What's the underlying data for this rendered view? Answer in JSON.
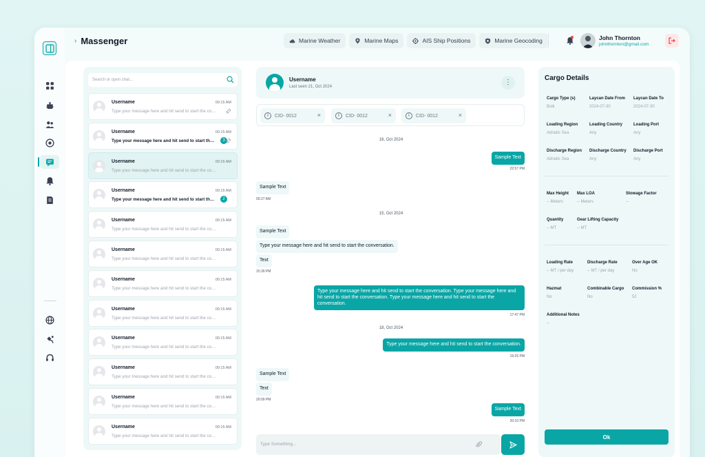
{
  "app": {
    "title": "Massenger"
  },
  "nav": {
    "buttons": [
      {
        "label": "Marine Weather",
        "icon": "cloud-icon"
      },
      {
        "label": "Marine Maps",
        "icon": "map-pin-icon"
      },
      {
        "label": "AIS Ship Positions",
        "icon": "crosshair-icon"
      },
      {
        "label": "Marine Geocoding",
        "icon": "shield-icon"
      }
    ]
  },
  "user": {
    "name": "John Thornton",
    "email": "johnthornton@gmail.com"
  },
  "chat_list": {
    "search_placeholder": "Search or open chat...",
    "items": [
      {
        "name": "Username",
        "time": "00:15 AM",
        "message": "Type your message here and hit send to start the conversation.",
        "unread": false,
        "badge": "",
        "pinned": true
      },
      {
        "name": "Username",
        "time": "00:15 AM",
        "message": "Type your message here and hit send to start the conversation.",
        "unread": true,
        "badge": "3",
        "pinned": true
      },
      {
        "name": "Username",
        "time": "00:15 AM",
        "message": "Type your message here and hit send to start the conversation.",
        "unread": false,
        "badge": "",
        "pinned": false
      },
      {
        "name": "Username",
        "time": "00:15 AM",
        "message": "Type your message here and hit send to start the conversation.",
        "unread": true,
        "badge": "2",
        "pinned": false
      },
      {
        "name": "Username",
        "time": "00:15 AM",
        "message": "Type your message here and hit send to start the conversation.",
        "unread": false,
        "badge": "",
        "pinned": false
      },
      {
        "name": "Username",
        "time": "00:15 AM",
        "message": "Type your message here and hit send to start the conversation.",
        "unread": false,
        "badge": "",
        "pinned": false
      },
      {
        "name": "Username",
        "time": "00:15 AM",
        "message": "Type your message here and hit send to start the conversation.",
        "unread": false,
        "badge": "",
        "pinned": false
      },
      {
        "name": "Username",
        "time": "00:15 AM",
        "message": "Type your message here and hit send to start the conversation.",
        "unread": false,
        "badge": "",
        "pinned": false
      },
      {
        "name": "Username",
        "time": "00:15 AM",
        "message": "Type your message here and hit send to start the conversation.",
        "unread": false,
        "badge": "",
        "pinned": false
      },
      {
        "name": "Username",
        "time": "00:15 AM",
        "message": "Type your message here and hit send to start the conversation.",
        "unread": false,
        "badge": "",
        "pinned": false
      },
      {
        "name": "Username",
        "time": "00:15 AM",
        "message": "Type your message here and hit send to start the conversation.",
        "unread": false,
        "badge": "",
        "pinned": false
      },
      {
        "name": "Username",
        "time": "00:15 AM",
        "message": "Type your message here and hit send to start the conversation.",
        "unread": false,
        "badge": "",
        "pinned": false
      }
    ]
  },
  "chat": {
    "contact_name": "Username",
    "last_seen": "Last seen 21, Oct 2024",
    "cids": [
      "CID- 0012",
      "CID- 0012",
      "CID- 0012"
    ],
    "dates": [
      "16, Oct 2024",
      "15, Oct 2024",
      "18, Oct 2024"
    ],
    "messages": {
      "m1": "Sample Text",
      "t1": "22:57 PM",
      "m2": "Sample Text",
      "t2": "00:27 AM",
      "m3": "Sample Text",
      "m4": "Type your message here and hit send to start the conversation.",
      "m5": "Text",
      "t5": "15:39 PM",
      "m6": "Type your message here and hit send to start the conversation. Type your message here and hit send to start the conversation. Type your message here and hit send to start the conversation.",
      "t6": "17:47 PM",
      "m7": "Type your message here and hit send to start the conversation.",
      "t7": "19:25 PM",
      "m8": "Sample Text",
      "m9": "Text",
      "t9": "20:09 PM",
      "m10": "Sample Text",
      "t10": "20:10 PM"
    },
    "composer_placeholder": "Type Something..."
  },
  "cargo": {
    "title": "Cargo Details",
    "f": {
      "cargo_type": [
        "Cargo Type (s)",
        "Bulk"
      ],
      "laycan_from": [
        "Laycan Date From",
        "2024-07-30"
      ],
      "laycan_to": [
        "Laycan Date To",
        "2024-07-30"
      ],
      "loading_region": [
        "Loading Region",
        "Adriatic Sea"
      ],
      "loading_country": [
        "Loading Country",
        "Any"
      ],
      "loading_port": [
        "Loading Port",
        "Any"
      ],
      "discharge_region": [
        "Discharge Region",
        "Adriatic Sea"
      ],
      "discharge_country": [
        "Discharge Country",
        "Any"
      ],
      "discharge_port": [
        "Discharge Port",
        "Any"
      ],
      "max_height": [
        "Max Height",
        "-- Meters"
      ],
      "max_loa": [
        "Max LOA",
        "-- Meters"
      ],
      "stowage": [
        "Stowage Factor",
        "--"
      ],
      "quantity": [
        "Quantity",
        "-- MT"
      ],
      "gear": [
        "Gear Lifting Capacity",
        "-- MT"
      ],
      "loading_rate": [
        "Loading Rate",
        "-- MT / per day"
      ],
      "discharge_rate": [
        "Discharge Rate",
        "-- MT / per day"
      ],
      "over_age": [
        "Over Age OK",
        "No"
      ],
      "hazmat": [
        "Hazmat",
        "No"
      ],
      "combinable": [
        "Combinable Cargo",
        "No"
      ],
      "commission": [
        "Commission %",
        "52"
      ],
      "notes": [
        "Additional Notes",
        "--"
      ]
    },
    "ok_label": "Ok"
  },
  "colors": {
    "accent": "#0aa6a6",
    "danger": "#ef4444"
  }
}
